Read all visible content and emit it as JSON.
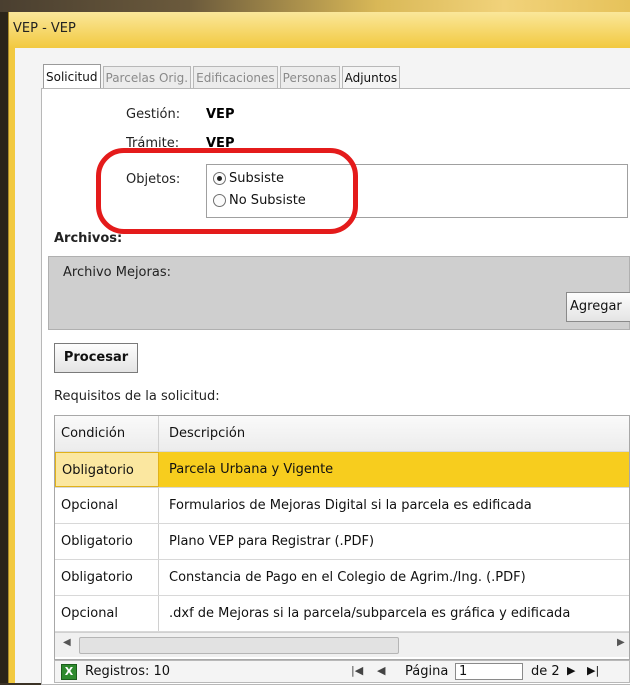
{
  "window": {
    "title": "VEP  -  VEP"
  },
  "tabs": [
    {
      "label": "Solicitud",
      "active": true
    },
    {
      "label": "Parcelas Orig.",
      "active": false
    },
    {
      "label": "Edificaciones",
      "active": false
    },
    {
      "label": "Personas",
      "active": false
    },
    {
      "label": "Adjuntos",
      "active": false
    }
  ],
  "form": {
    "gestion_label": "Gestión:",
    "gestion_value": "VEP",
    "tramite_label": "Trámite:",
    "tramite_value": "VEP",
    "objetos_label": "Objetos:",
    "options": [
      {
        "label": "Subsiste",
        "selected": true
      },
      {
        "label": "No Subsiste",
        "selected": false
      }
    ]
  },
  "archivos": {
    "heading": "Archivos:",
    "mejoras_label": "Archivo Mejoras:",
    "agregar_label": "Agregar"
  },
  "procesar_label": "Procesar",
  "requisitos": {
    "heading": "Requisitos de la solicitud:",
    "columns": [
      "Condición",
      "Descripción"
    ],
    "rows": [
      {
        "condicion": "Obligatorio",
        "descripcion": "Parcela Urbana y Vigente",
        "selected": true
      },
      {
        "condicion": "Opcional",
        "descripcion": "Formularios de Mejoras Digital si la parcela es edificada",
        "selected": false
      },
      {
        "condicion": "Obligatorio",
        "descripcion": "Plano VEP para Registrar (.PDF)",
        "selected": false
      },
      {
        "condicion": "Obligatorio",
        "descripcion": "Constancia de Pago en el Colegio de Agrim./Ing. (.PDF)",
        "selected": false
      },
      {
        "condicion": "Opcional",
        "descripcion": ".dxf de Mejoras si la parcela/subparcela es gráfica y edificada",
        "selected": false
      }
    ]
  },
  "pager": {
    "registros": "Registros: 10",
    "pagina_label": "Página",
    "pagina_value": "1",
    "de_label": "de 2"
  },
  "colors": {
    "selection": "#f7cd1e",
    "annotation": "#e41b1b",
    "window_frame": "#f2c940"
  }
}
